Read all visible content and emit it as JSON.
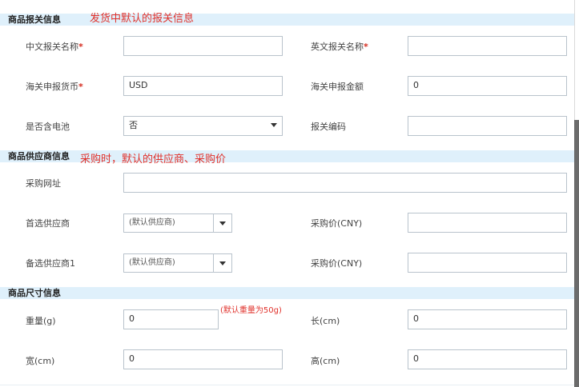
{
  "customs": {
    "title": "商品报关信息",
    "note": "发货中默认的报关信息",
    "cn_name_label": "中文报关名称",
    "en_name_label": "英文报关名称",
    "currency_label": "海关申报货币",
    "currency_value": "USD",
    "amount_label": "海关申报金额",
    "amount_value": "0",
    "battery_label": "是否含电池",
    "battery_value": "否",
    "hs_code_label": "报关编码",
    "required_mark": "*"
  },
  "supplier": {
    "title": "商品供应商信息",
    "note": "采购时，默认的供应商、采购价",
    "url_label": "采购网址",
    "primary_label": "首选供应商",
    "primary_value": "(默认供应商)",
    "price1_label": "采购价(CNY)",
    "backup_label": "备选供应商1",
    "backup_value": "(默认供应商)",
    "price2_label": "采购价(CNY)"
  },
  "size": {
    "title": "商品尺寸信息",
    "weight_label": "重量(g)",
    "weight_value": "0",
    "weight_note": "(默认重量为50g)",
    "length_label": "长(cm)",
    "length_value": "0",
    "width_label": "宽(cm)",
    "width_value": "0",
    "height_label": "高(cm)",
    "height_value": "0"
  },
  "colors": {
    "section_bg": "#dff0fb",
    "note_red": "#e0312b",
    "input_border": "#b9c3cc"
  }
}
